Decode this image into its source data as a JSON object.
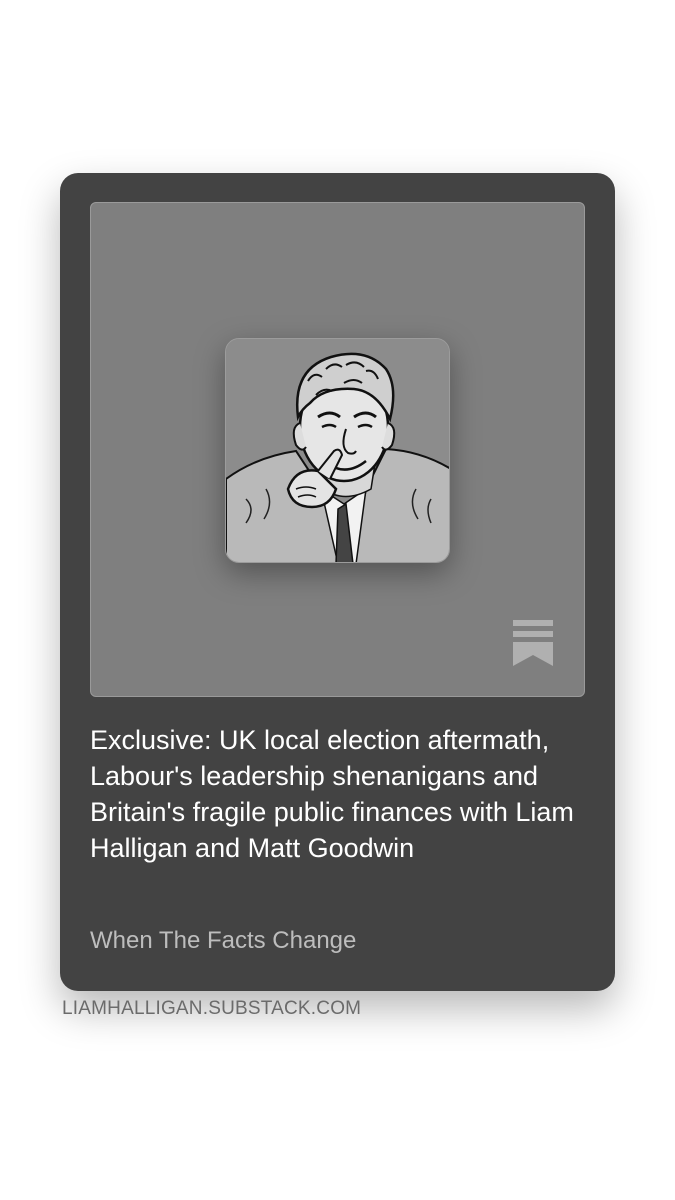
{
  "card": {
    "title": "Exclusive: UK local election aftermath, Labour's leadership shenanigans and Britain's fragile public finances with Liam Halligan and Matt Goodwin",
    "publication": "When The Facts Change",
    "domain": "LIAMHALLIGAN.SUBSTACK.COM",
    "cover_icon": "substack-bookmark-icon",
    "avatar_icon": "sketch-portrait-pointing-man"
  },
  "colors": {
    "card_background": "#434343",
    "cover_background": "#7f7f7f",
    "title_text": "#ffffff",
    "publication_text": "#bdbdbd",
    "domain_text": "#6b6b6b"
  }
}
